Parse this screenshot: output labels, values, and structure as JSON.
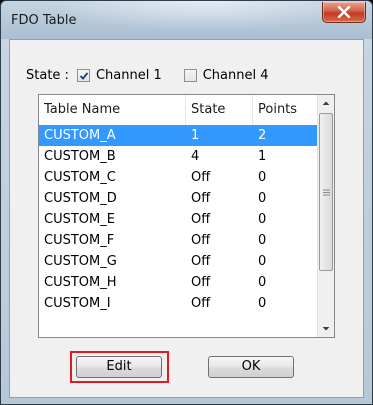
{
  "window": {
    "title": "FDO Table"
  },
  "state": {
    "label": "State :",
    "channels": [
      {
        "label": "Channel 1",
        "checked": true
      },
      {
        "label": "Channel 4",
        "checked": false
      }
    ]
  },
  "table": {
    "columns": [
      "Table Name",
      "State",
      "Points"
    ],
    "rows": [
      {
        "name": "CUSTOM_A",
        "state": "1",
        "points": "2",
        "selected": true
      },
      {
        "name": "CUSTOM_B",
        "state": "4",
        "points": "1"
      },
      {
        "name": "CUSTOM_C",
        "state": "Off",
        "points": "0"
      },
      {
        "name": "CUSTOM_D",
        "state": "Off",
        "points": "0"
      },
      {
        "name": "CUSTOM_E",
        "state": "Off",
        "points": "0"
      },
      {
        "name": "CUSTOM_F",
        "state": "Off",
        "points": "0"
      },
      {
        "name": "CUSTOM_G",
        "state": "Off",
        "points": "0"
      },
      {
        "name": "CUSTOM_H",
        "state": "Off",
        "points": "0"
      },
      {
        "name": "CUSTOM_I",
        "state": "Off",
        "points": "0"
      }
    ]
  },
  "buttons": {
    "edit": "Edit",
    "ok": "OK"
  },
  "colors": {
    "selection": "#3399ff",
    "highlight_box": "#e01b22",
    "close_button": "#c23b22"
  },
  "icons": {
    "close": "close-x-icon",
    "check": "checkmark-icon",
    "scroll_up": "arrow-up-icon",
    "scroll_down": "arrow-down-icon"
  }
}
